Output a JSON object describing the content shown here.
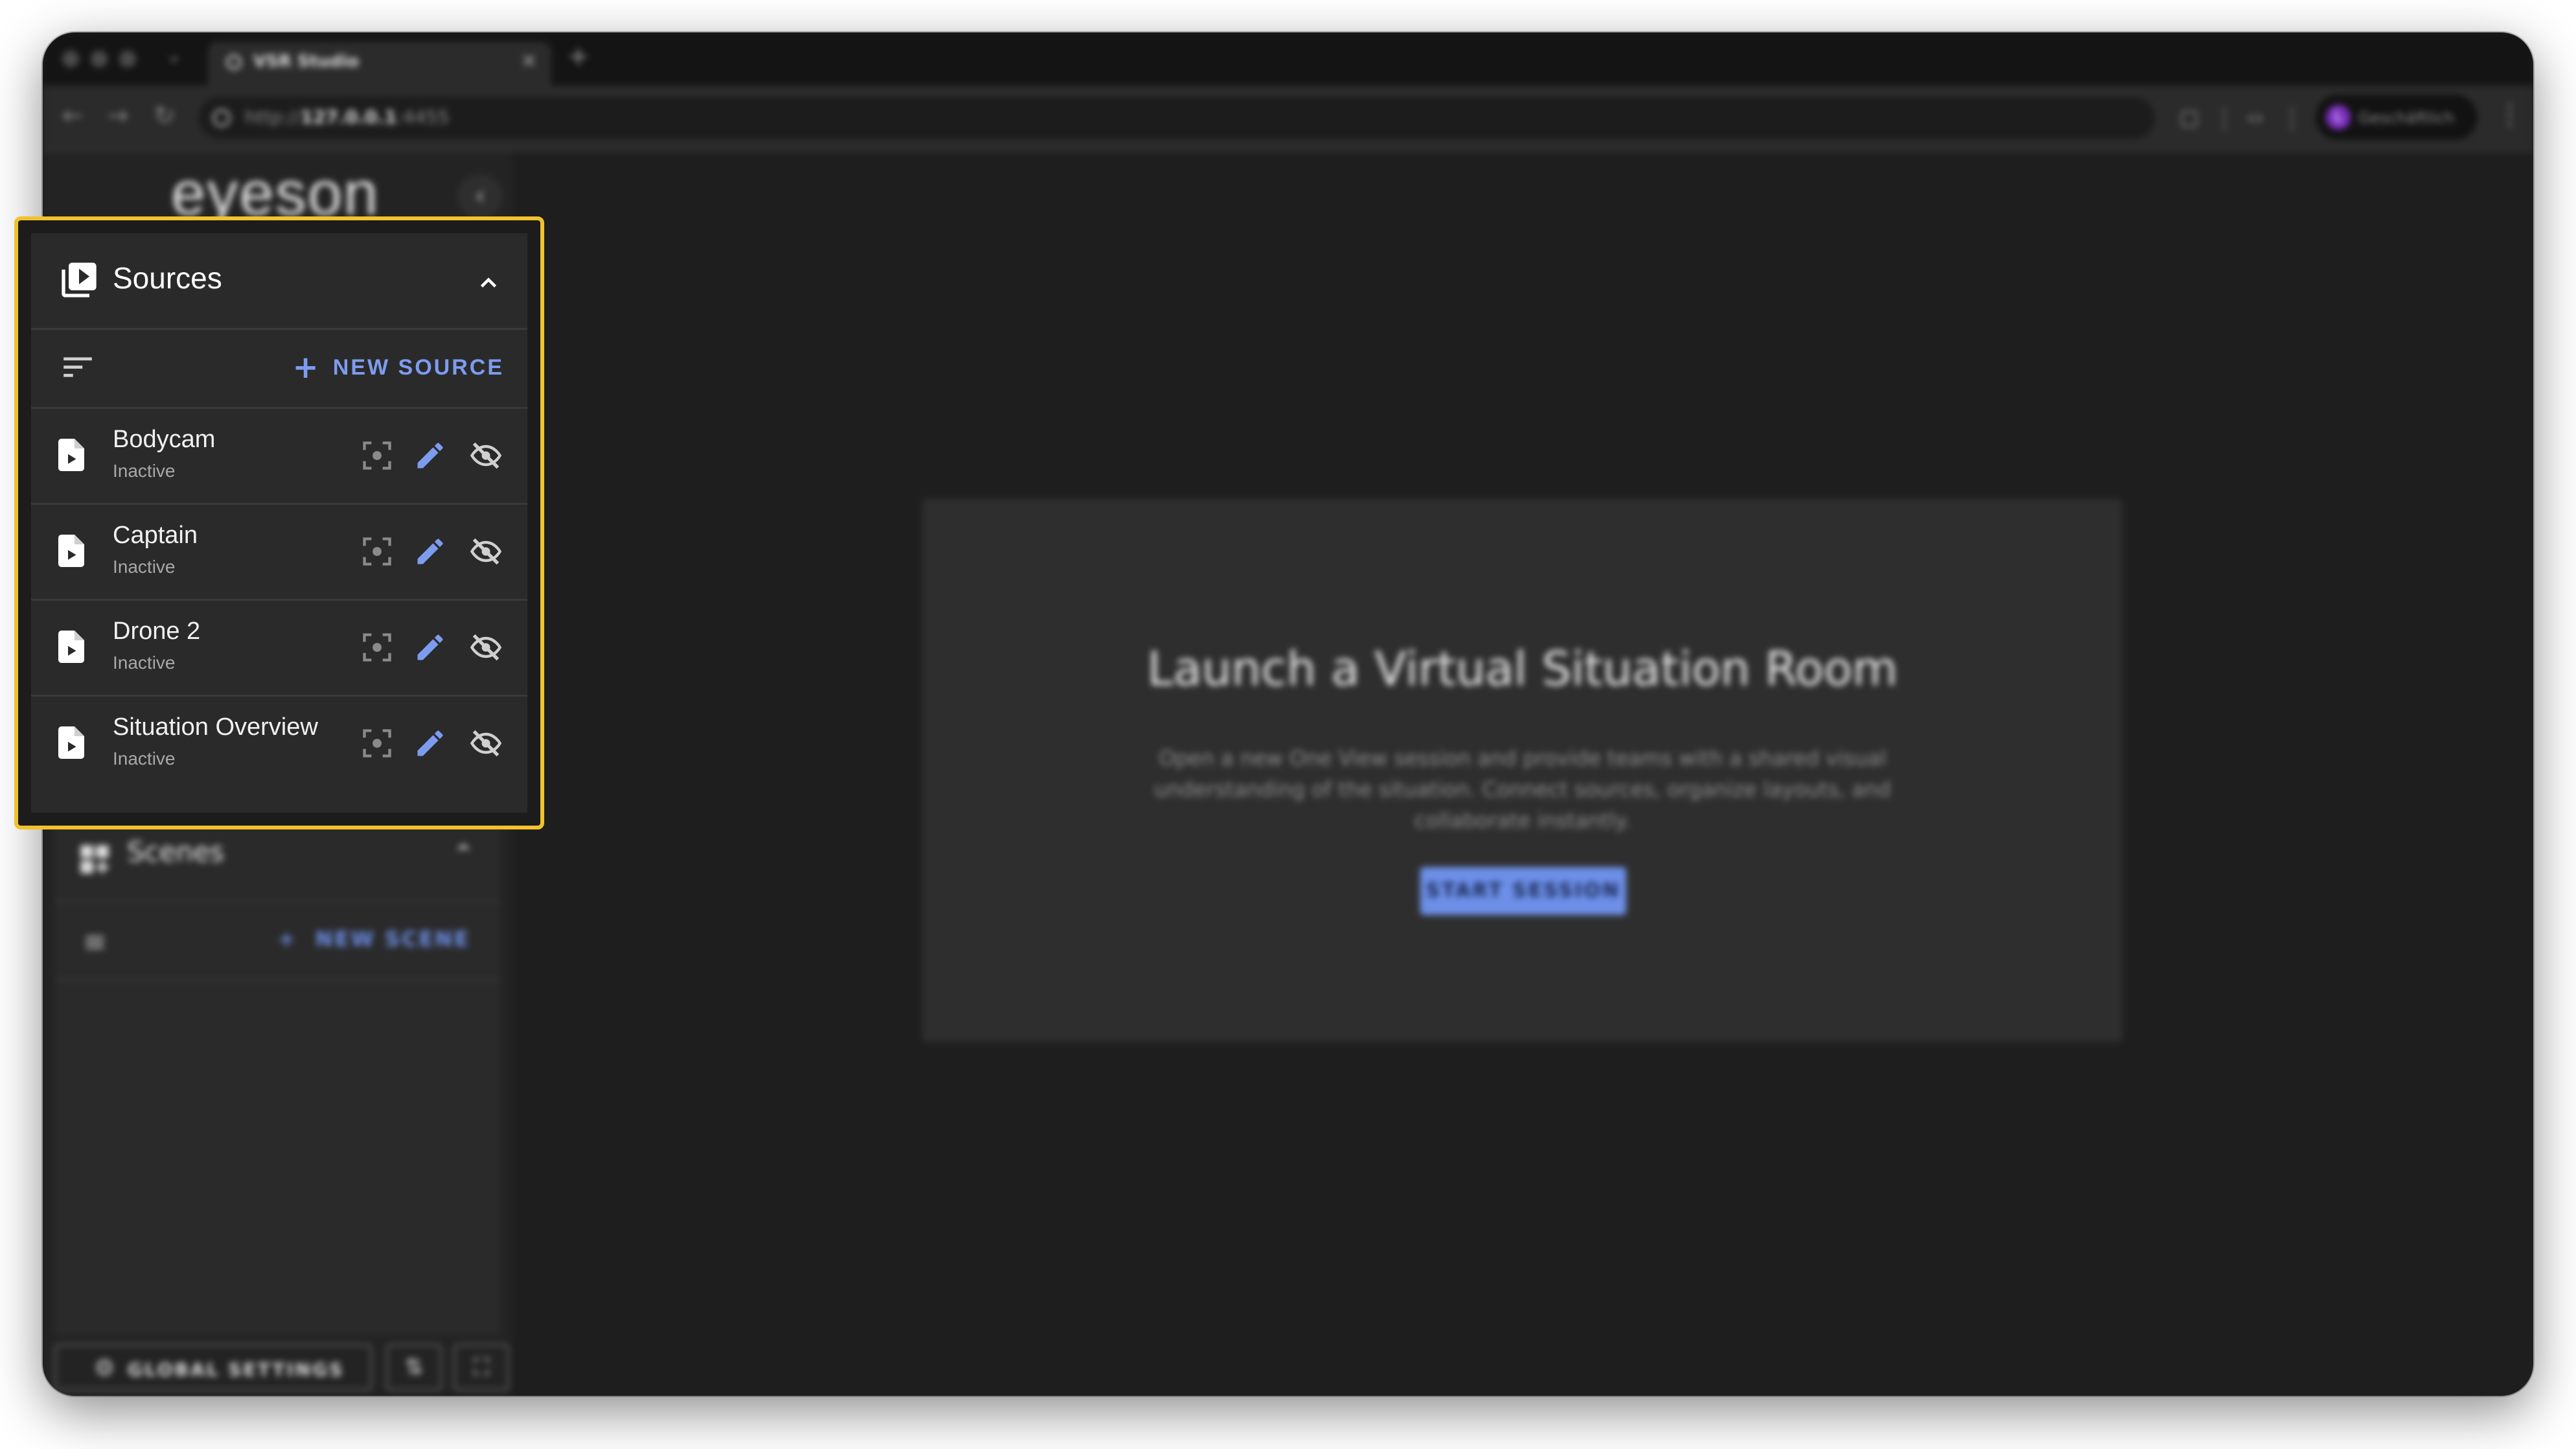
{
  "browser": {
    "tab_title": "VSR Studio",
    "url_prefix": "http://",
    "url_host": "127.0.0.1",
    "url_port": ":4455",
    "profile_initial": "L",
    "profile_name": "Geschäftlich"
  },
  "sidebar": {
    "logo": "eyeson",
    "sources": {
      "title": "Sources",
      "new_label": "NEW SOURCE",
      "items": [
        {
          "name": "Bodycam",
          "status": "Inactive"
        },
        {
          "name": "Captain",
          "status": "Inactive"
        },
        {
          "name": "Drone 2",
          "status": "Inactive"
        },
        {
          "name": "Situation Overview",
          "status": "Inactive"
        }
      ]
    },
    "scenes": {
      "title": "Scenes",
      "new_label": "NEW SCENE"
    },
    "global_settings_label": "GLOBAL SETTINGS"
  },
  "main": {
    "title": "Launch a Virtual Situation Room",
    "description": "Open a new One View session and provide teams with a shared visual understanding of the situation. Connect sources, organize layouts, and collaborate instantly.",
    "start_label": "START SESSION"
  },
  "colors": {
    "accent": "#7d9cf0",
    "highlight": "#f2c12e",
    "panel": "#2a2a2a",
    "background": "#1e1e1e"
  }
}
